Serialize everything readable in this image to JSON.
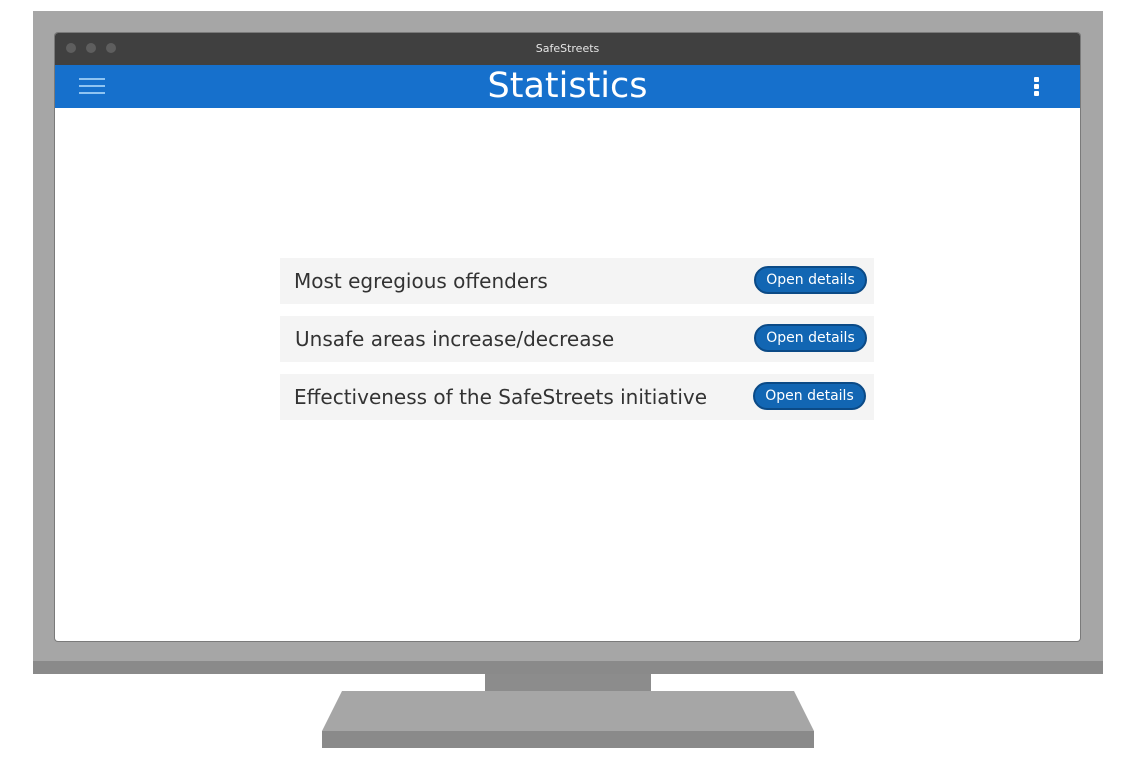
{
  "window": {
    "title": "SafeStreets"
  },
  "appbar": {
    "title": "Statistics",
    "menu_icon": "hamburger-menu-icon",
    "more_icon": "vertical-ellipsis-icon",
    "color": "#1670cc"
  },
  "stats": {
    "items": [
      {
        "label": "Most egregious offenders",
        "button": "Open details"
      },
      {
        "label": "Unsafe areas increase/decrease",
        "button": "Open details"
      },
      {
        "label": "Effectiveness of the SafeStreets initiative",
        "button": "Open details"
      }
    ]
  },
  "colors": {
    "button": "#1266b3",
    "row_background": "#f4f4f4"
  }
}
